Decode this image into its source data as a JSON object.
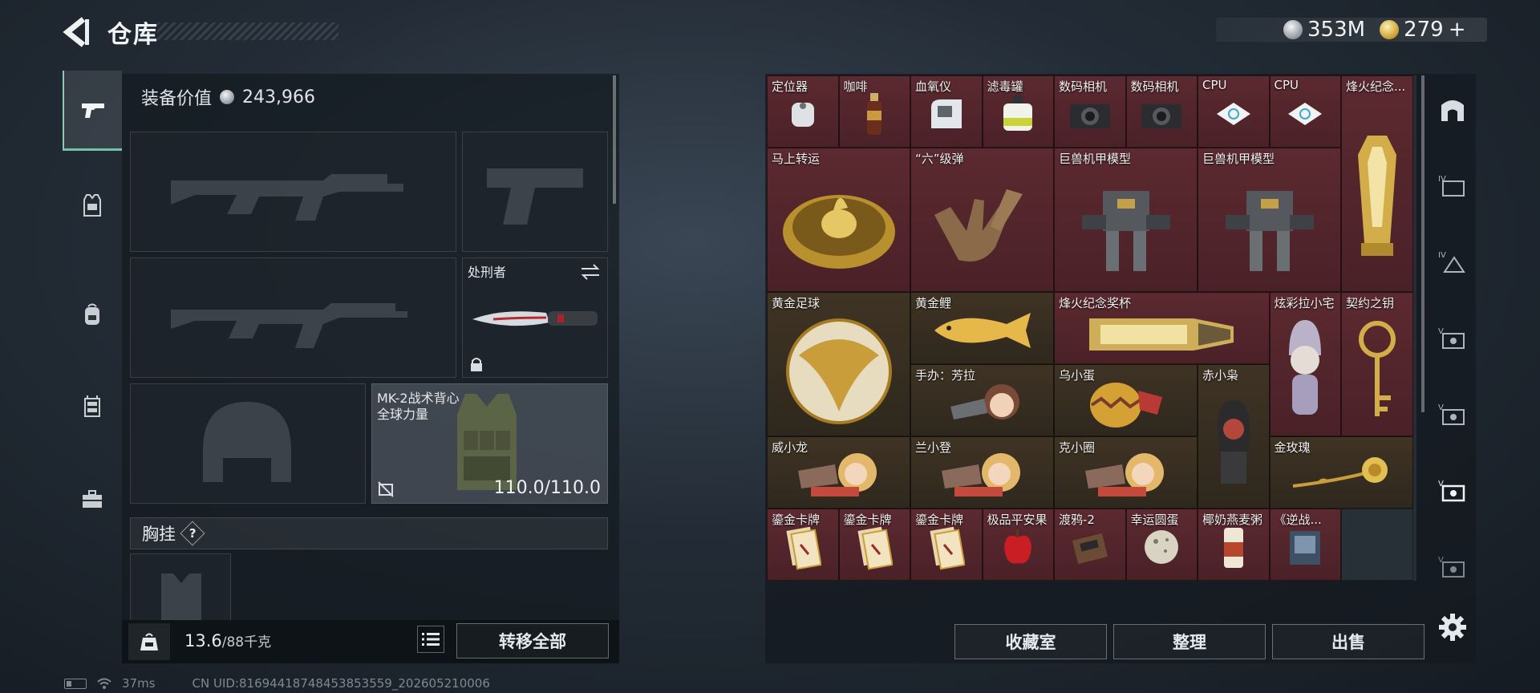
{
  "header": {
    "title": "仓库",
    "silver_currency": "353M",
    "gold_currency": "279",
    "gold_plus": "+"
  },
  "left_nav": {
    "items": [
      {
        "id": "weapons",
        "icon": "pistol-icon",
        "active": true
      },
      {
        "id": "armor",
        "icon": "armor-vest-icon",
        "active": false
      },
      {
        "id": "backpack",
        "icon": "backpack-icon",
        "active": false
      },
      {
        "id": "chest-rig",
        "icon": "chest-rig-icon",
        "active": false
      },
      {
        "id": "case",
        "icon": "briefcase-icon",
        "active": false
      }
    ]
  },
  "loadout": {
    "equip_value_label": "装备价值",
    "equip_value": "243,966",
    "melee_name": "处刑者",
    "armor_name": "MK-2战术背心",
    "armor_faction": "全球力量",
    "armor_durability": "110.0/110.0",
    "chest_rig_label": "胸挂",
    "chest_rig_help": "?",
    "weight_current": "13.6",
    "weight_max": "/88千克",
    "transfer_all": "转移全部"
  },
  "status_bar": {
    "ping": "37ms",
    "uid": "CN UID:8169441874845385355​9_202605210006"
  },
  "stash": {
    "items": [
      {
        "label": "定位器",
        "bg": "red"
      },
      {
        "label": "咖啡",
        "bg": "red"
      },
      {
        "label": "血氧仪",
        "bg": "red"
      },
      {
        "label": "滤毒罐",
        "bg": "red"
      },
      {
        "label": "数码相机",
        "bg": "red"
      },
      {
        "label": "数码相机",
        "bg": "red"
      },
      {
        "label": "CPU",
        "bg": "red"
      },
      {
        "label": "CPU",
        "bg": "red"
      },
      {
        "label": "烽火纪念...",
        "bg": "red"
      },
      {
        "label": "马上转运",
        "bg": "red"
      },
      {
        "label": "“六”级弹",
        "bg": "red"
      },
      {
        "label": "巨兽机甲模型",
        "bg": "red"
      },
      {
        "label": "巨兽机甲模型",
        "bg": "red"
      },
      {
        "label": "黄金足球",
        "bg": "gold"
      },
      {
        "label": "黄金鲤",
        "bg": "gold"
      },
      {
        "label": "烽火纪念奖杯",
        "bg": "red"
      },
      {
        "label": "炫彩拉小宅",
        "bg": "red"
      },
      {
        "label": "契约之钥",
        "bg": "red"
      },
      {
        "label": "手办：芳拉",
        "bg": "gold"
      },
      {
        "label": "乌小蛋",
        "bg": "gold"
      },
      {
        "label": "赤小枭",
        "bg": "gold"
      },
      {
        "label": "威小龙",
        "bg": "gold"
      },
      {
        "label": "兰小登",
        "bg": "gold"
      },
      {
        "label": "克小圈",
        "bg": "gold"
      },
      {
        "label": "金玫瑰",
        "bg": "gold"
      },
      {
        "label": "鎏金卡牌",
        "bg": "red"
      },
      {
        "label": "鎏金卡牌",
        "bg": "red"
      },
      {
        "label": "鎏金卡牌",
        "bg": "red"
      },
      {
        "label": "极品平安果",
        "bg": "red"
      },
      {
        "label": "渡鸦-2",
        "bg": "red"
      },
      {
        "label": "幸运圆蛋",
        "bg": "red"
      },
      {
        "label": "椰奶燕麦粥",
        "bg": "red"
      },
      {
        "label": "《逆战...",
        "bg": "red"
      }
    ],
    "buttons": {
      "collection": "收藏室",
      "sort": "整理",
      "sell": "出售"
    }
  },
  "right_nav": {
    "items": [
      {
        "id": "stash-main",
        "icon": "stash-arch-icon"
      },
      {
        "id": "stash-4",
        "icon": "stash-tab-4-icon"
      },
      {
        "id": "stash-4b",
        "icon": "stash-tab-4b-icon"
      },
      {
        "id": "stash-5a",
        "icon": "stash-tab-5a-icon"
      },
      {
        "id": "stash-5b",
        "icon": "stash-tab-5b-icon"
      },
      {
        "id": "stash-5c",
        "icon": "stash-tab-5c-icon"
      },
      {
        "id": "stash-5d",
        "icon": "stash-tab-5d-icon"
      },
      {
        "id": "settings",
        "icon": "gear-icon"
      }
    ]
  },
  "colors": {
    "accent_teal": "#6fc3a8",
    "cell_red": "#5b2a30",
    "cell_gold": "#3f3324"
  }
}
